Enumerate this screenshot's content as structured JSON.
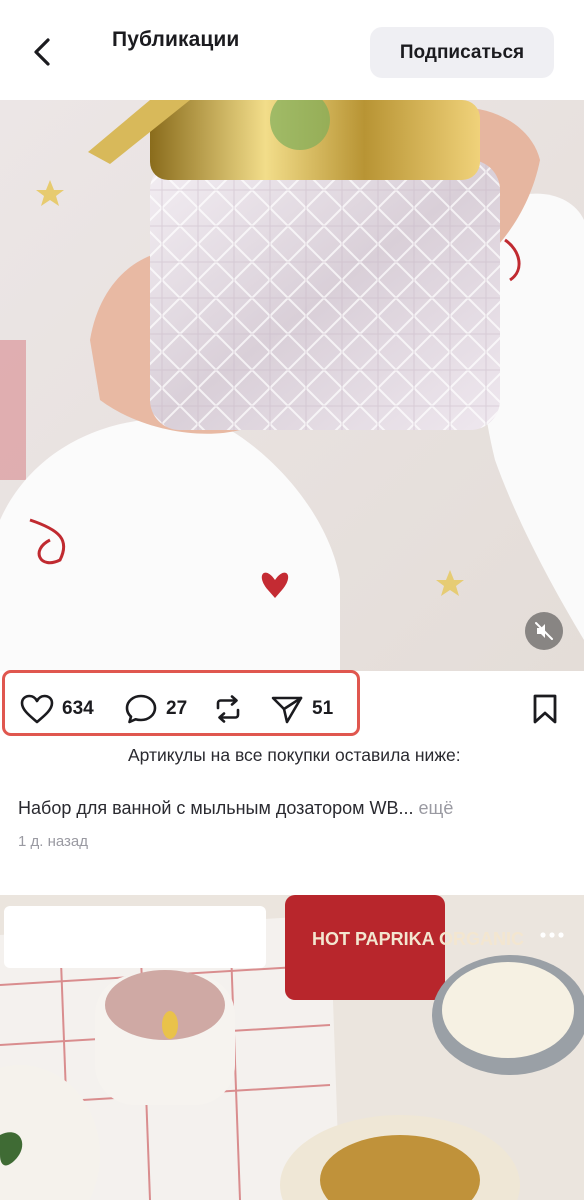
{
  "header": {
    "title": "Публикации",
    "subscribe_label": "Подписаться"
  },
  "post": {
    "likes": "634",
    "comments": "27",
    "shares": "51",
    "caption_line1": "Артикулы на все покупки оставила ниже:",
    "caption_line2": "Набор для ванной с мыльным дозатором WB...",
    "more_label": "ещё",
    "timestamp": "1 д. назад"
  },
  "next_post": {
    "product_label": "HOT PAPRIKA ORGANIC"
  },
  "colors": {
    "highlight": "#e0574f",
    "muted_text": "#9a9aa2",
    "button_bg": "#efeff3"
  }
}
